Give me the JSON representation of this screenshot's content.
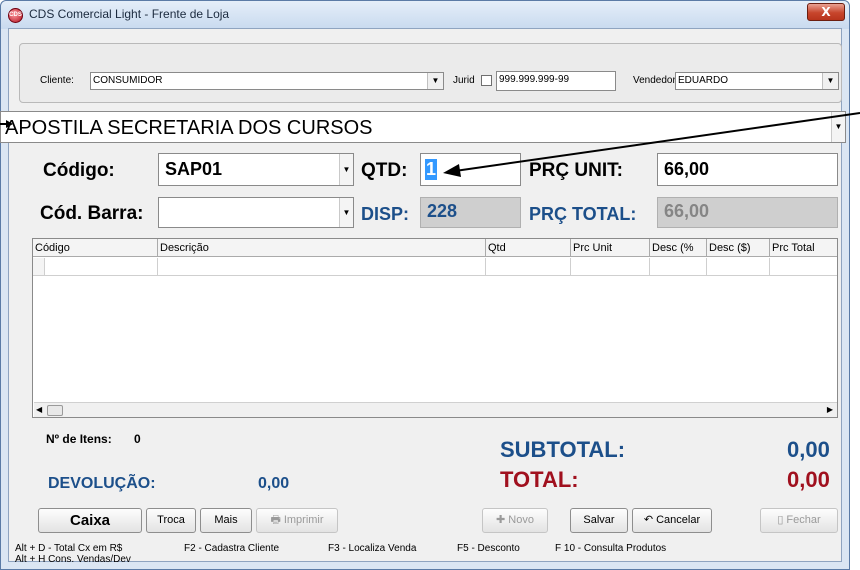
{
  "window": {
    "title": "CDS Comercial Light - Frente de Loja",
    "icon_text": "CDS",
    "close_label": "X"
  },
  "cliente_bar": {
    "cliente_label": "Cliente:",
    "cliente_value": "CONSUMIDOR",
    "jurid_label": "Jurid",
    "jurid_checked": false,
    "documento_value": "999.999.999-99",
    "vendedor_label": "Vendedor:",
    "vendedor_value": "EDUARDO"
  },
  "produto": {
    "descricao_value": "APOSTILA SECRETARIA DOS CURSOS",
    "codigo_label": "Código:",
    "codigo_value": "SAP01",
    "qtd_label": "QTD:",
    "qtd_value": "1",
    "prc_unit_label": "PRÇ UNIT:",
    "prc_unit_value": "66,00",
    "cod_barra_label": "Cód. Barra:",
    "cod_barra_value": "",
    "disp_label": "DISP:",
    "disp_value": "228",
    "prc_total_label": "PRÇ TOTAL:",
    "prc_total_value": "66,00"
  },
  "grid": {
    "columns": [
      "Código",
      "Descrição",
      "Qtd",
      "Prc Unit",
      "Desc (%",
      "Desc ($)",
      "Prc Total"
    ]
  },
  "totals": {
    "itens_label": "Nº de Itens:",
    "itens_value": "0",
    "devolucao_label": "DEVOLUÇÃO:",
    "devolucao_value": "0,00",
    "subtotal_label": "SUBTOTAL:",
    "subtotal_value": "0,00",
    "total_label": "TOTAL:",
    "total_value": "0,00"
  },
  "buttons": {
    "caixa": "Caixa",
    "troca": "Troca",
    "mais": "Mais",
    "imprimir": "Imprimir",
    "novo": "Novo",
    "salvar": "Salvar",
    "cancelar": "Cancelar",
    "fechar": "Fechar"
  },
  "status_bar": {
    "line1": "Alt + D - Total Cx em R$",
    "line2": "Alt + H Cons. Vendas/Dev",
    "f2": "F2 - Cadastra Cliente",
    "f3": "F3 - Localiza Venda",
    "f5": "F5 - Desconto",
    "f10": "F 10 - Consulta Produtos"
  },
  "colors": {
    "navy_text": "#1c4f8a",
    "red_text": "#a0101e",
    "selection": "#3399ff"
  }
}
